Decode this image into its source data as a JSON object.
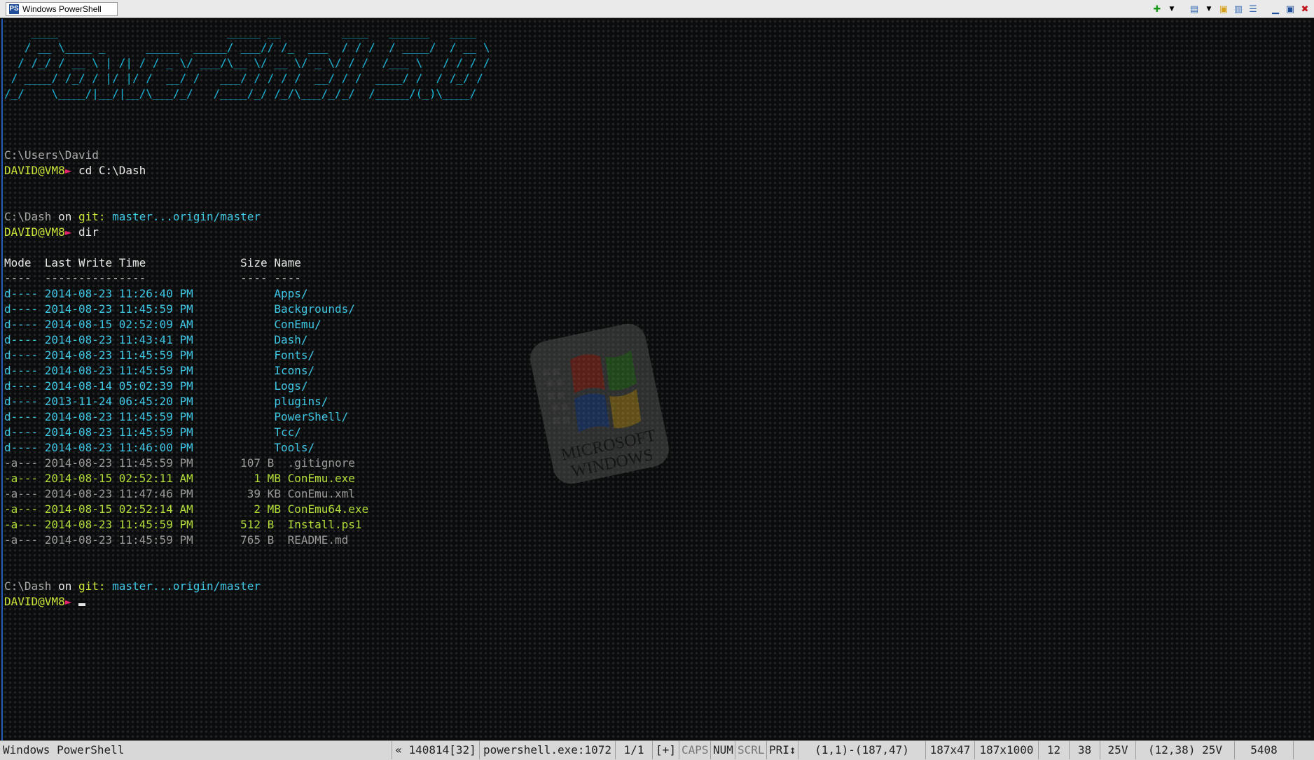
{
  "window": {
    "title": "Windows PowerShell",
    "tab_icon": "PS",
    "controls": [
      "add-tab-icon",
      "dropdown-icon",
      "layout-icon",
      "dropdown-icon",
      "lock-icon",
      "split-view-icon",
      "menu-icon",
      "minimize-icon",
      "maximize-icon",
      "close-icon"
    ]
  },
  "terminal": {
    "banner": [
      "    ____                         _____ __         ____   ______   ____",
      "   / __ \\____ _      _____  _____/ ___// /_  ___  / / /  / ____/  / __ \\",
      "  / /_/ / __ \\ | /| / / _ \\/ ___/\\__ \\/ __ \\/ _ \\/ / /  /___ \\   / / / /",
      " / ____/ /_/ / |/ |/ /  __/ /   ___/ / / / /  __/ / /  ____/ /  / /_/ /",
      "/_/    \\____/|__/|__/\\___/_/   /____/_/ /_/\\___/_/_/  /_____/(_)\\____/"
    ],
    "session1": {
      "path": "C:\\Users\\David",
      "user": "DAVID@VM8",
      "arrow": "►",
      "command": " cd C:\\Dash"
    },
    "session2": {
      "path": "C:\\Dash",
      "on": " on ",
      "git_label": "git:",
      "branch": " master...origin/master",
      "user": "DAVID@VM8",
      "arrow": "►",
      "command": " dir"
    },
    "dir_header": "Mode  Last Write Time              Size Name",
    "dir_rule": "----  ---------------              ---- ----",
    "dir_rows": [
      {
        "line": "d---- 2014-08-23 11:26:40 PM            Apps/",
        "kind": "dir"
      },
      {
        "line": "d---- 2014-08-23 11:45:59 PM            Backgrounds/",
        "kind": "dir"
      },
      {
        "line": "d---- 2014-08-15 02:52:09 AM            ConEmu/",
        "kind": "dir"
      },
      {
        "line": "d---- 2014-08-23 11:43:41 PM            Dash/",
        "kind": "dir"
      },
      {
        "line": "d---- 2014-08-23 11:45:59 PM            Fonts/",
        "kind": "dir"
      },
      {
        "line": "d---- 2014-08-23 11:45:59 PM            Icons/",
        "kind": "dir"
      },
      {
        "line": "d---- 2014-08-14 05:02:39 PM            Logs/",
        "kind": "dir"
      },
      {
        "line": "d---- 2013-11-24 06:45:20 PM            plugins/",
        "kind": "dir"
      },
      {
        "line": "d---- 2014-08-23 11:45:59 PM            PowerShell/",
        "kind": "dir"
      },
      {
        "line": "d---- 2014-08-23 11:45:59 PM            Tcc/",
        "kind": "dir"
      },
      {
        "line": "d---- 2014-08-23 11:46:00 PM            Tools/",
        "kind": "dir"
      },
      {
        "line": "-a--- 2014-08-23 11:45:59 PM       107 B  .gitignore",
        "kind": "file"
      },
      {
        "line": "-a--- 2014-08-15 02:52:11 AM         1 MB ConEmu.exe",
        "kind": "exec"
      },
      {
        "line": "-a--- 2014-08-23 11:47:46 PM        39 KB ConEmu.xml",
        "kind": "file"
      },
      {
        "line": "-a--- 2014-08-15 02:52:14 AM         2 MB ConEmu64.exe",
        "kind": "exec"
      },
      {
        "line": "-a--- 2014-08-23 11:45:59 PM       512 B  Install.ps1",
        "kind": "exec"
      },
      {
        "line": "-a--- 2014-08-23 11:45:59 PM       765 B  README.md",
        "kind": "file"
      }
    ],
    "session3": {
      "path": "C:\\Dash",
      "on": " on ",
      "git_label": "git:",
      "branch": " master...origin/master",
      "user": "DAVID@VM8",
      "arrow": "►"
    }
  },
  "watermark": {
    "line1": "MICROSOFT",
    "line2": "WINDOWS"
  },
  "statusbar": {
    "title": "Windows PowerShell",
    "cells": [
      {
        "text": "« 140814[32]",
        "muted": false
      },
      {
        "text": "powershell.exe:1072",
        "muted": false
      },
      {
        "text": "1/1",
        "muted": false
      },
      {
        "text": "[+]",
        "muted": false
      },
      {
        "text": "CAPS",
        "muted": true
      },
      {
        "text": "NUM",
        "muted": false
      },
      {
        "text": "SCRL",
        "muted": true
      },
      {
        "text": "PRI↕",
        "muted": false
      },
      {
        "text": "(1,1)-(187,47)",
        "muted": false
      },
      {
        "text": "187x47",
        "muted": false
      },
      {
        "text": "187x1000",
        "muted": false
      },
      {
        "text": "12",
        "muted": false
      },
      {
        "text": "38",
        "muted": false
      },
      {
        "text": "25V",
        "muted": false
      },
      {
        "text": "(12,38) 25V",
        "muted": false
      },
      {
        "text": "5408",
        "muted": false
      }
    ]
  },
  "colors": {
    "ascii": "#1ab3d6",
    "user": "#cde53a",
    "arrow": "#e0246e",
    "dir": "#3ec7e6",
    "exec": "#b3de3a",
    "file": "#9a9a9a"
  }
}
